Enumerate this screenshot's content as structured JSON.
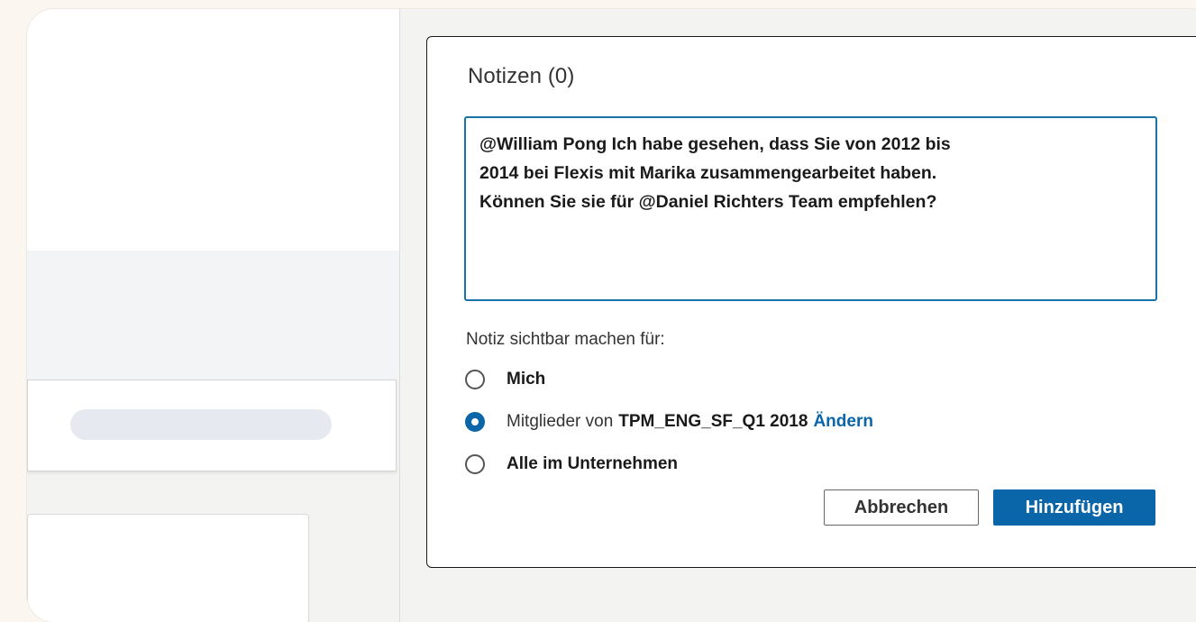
{
  "notes": {
    "title": "Notizen (0)",
    "text": "@William Pong Ich habe gesehen, dass Sie von 2012 bis\n2014 bei Flexis mit Marika zusammengearbeitet haben.\nKönnen Sie sie für @Daniel Richters Team empfehlen?"
  },
  "visibility": {
    "label": "Notiz sichtbar machen für:",
    "options": [
      {
        "label": "Mich",
        "checked": false
      },
      {
        "prefix": "Mitglieder von",
        "group": "TPM_ENG_SF_Q1 2018",
        "link": "Ändern",
        "checked": true
      },
      {
        "label": "Alle im Unternehmen",
        "checked": false
      }
    ]
  },
  "actions": {
    "cancel_label": "Abbrechen",
    "add_label": "Hinzufügen"
  },
  "colors": {
    "accent": "#0a66a8",
    "page_background": "#fbf6f0",
    "panel_background": "#ffffff"
  }
}
